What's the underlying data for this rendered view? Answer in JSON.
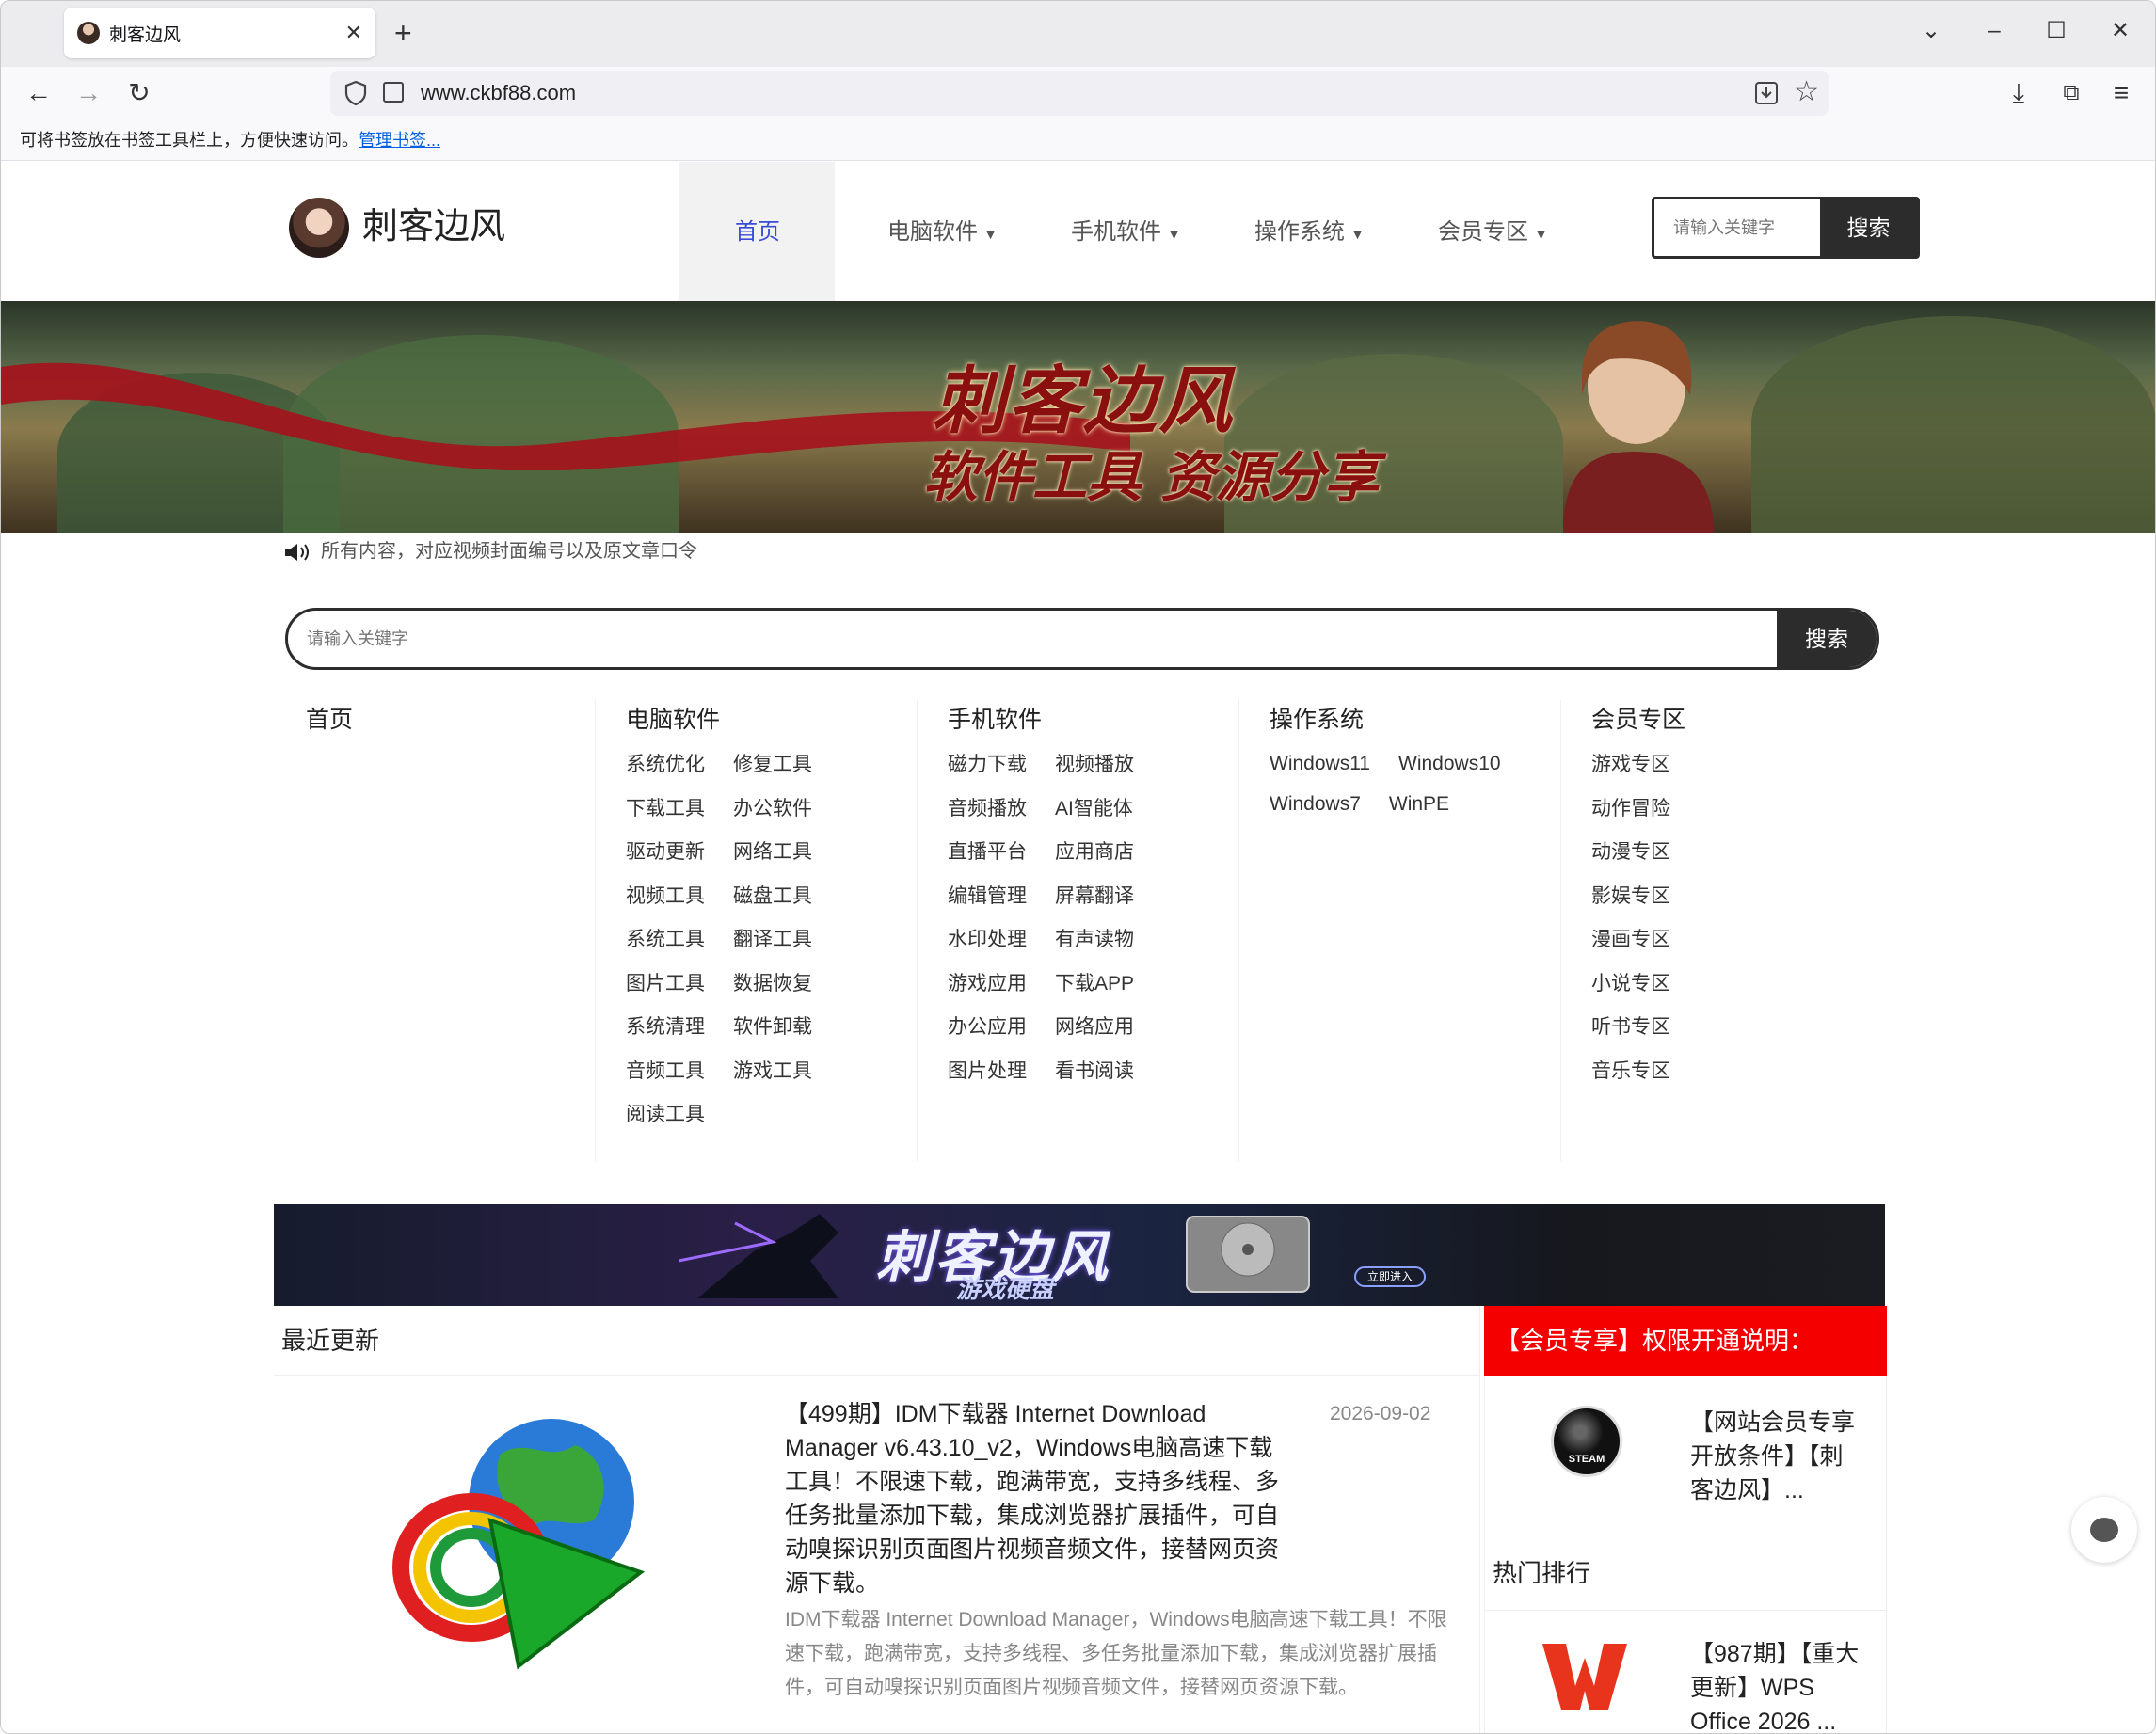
{
  "browser": {
    "tab_title": "刺客边风",
    "url": "www.ckbf88.com",
    "bookmark_hint": "可将书签放在书签工具栏上，方便快速访问。",
    "bookmark_link": "管理书签..."
  },
  "header": {
    "logo_text": "刺客边风",
    "nav": [
      "首页",
      "电脑软件",
      "手机软件",
      "操作系统",
      "会员专区"
    ],
    "search_placeholder": "请输入关键字",
    "search_button": "搜索"
  },
  "banner": {
    "title": "刺客边风",
    "subtitle": "软件工具 资源分享"
  },
  "notice": "所有内容，对应视频封面编号以及原文章口令",
  "big_search": {
    "placeholder": "请输入关键字",
    "button": "搜索"
  },
  "categories": {
    "home": "首页",
    "pc": {
      "title": "电脑软件",
      "items": [
        "系统优化",
        "修复工具",
        "下载工具",
        "办公软件",
        "驱动更新",
        "网络工具",
        "视频工具",
        "磁盘工具",
        "系统工具",
        "翻译工具",
        "图片工具",
        "数据恢复",
        "系统清理",
        "软件卸载",
        "音频工具",
        "游戏工具",
        "阅读工具"
      ]
    },
    "mobile": {
      "title": "手机软件",
      "items": [
        "磁力下载",
        "视频播放",
        "音频播放",
        "AI智能体",
        "直播平台",
        "应用商店",
        "编辑管理",
        "屏幕翻译",
        "水印处理",
        "有声读物",
        "游戏应用",
        "下载APP",
        "办公应用",
        "网络应用",
        "图片处理",
        "看书阅读"
      ]
    },
    "os": {
      "title": "操作系统",
      "items": [
        "Windows11",
        "Windows10",
        "Windows7",
        "WinPE"
      ]
    },
    "vip": {
      "title": "会员专区",
      "items": [
        "游戏专区",
        "动作冒险",
        "动漫专区",
        "影娱专区",
        "漫画专区",
        "小说专区",
        "听书专区",
        "音乐专区"
      ]
    }
  },
  "ad": {
    "title": "刺客边风",
    "subtitle": "游戏硬盘",
    "button": "立即进入"
  },
  "recent": {
    "header": "最近更新",
    "post": {
      "title": "【499期】IDM下载器 Internet Download Manager v6.43.10_v2，Windows电脑高速下载工具！不限速下载，跑满带宽，支持多线程、多任务批量添加下载，集成浏览器扩展插件，可自动嗅探识别页面图片视频音频文件，接替网页资源下载。",
      "date": "2026-09-02",
      "desc": "IDM下载器 Internet Download Manager，Windows电脑高速下载工具！不限速下载，跑满带宽，支持多线程、多任务批量添加下载，集成浏览器扩展插件，可自动嗅探识别页面图片视频音频文件，接替网页资源下载。"
    }
  },
  "sidebar": {
    "vip_header": "【会员专享】权限开通说明：",
    "vip_post": "【网站会员专享开放条件】【刺客边风】...",
    "steam_label": "STEAM",
    "hot_header": "热门排行",
    "hot_post": "【987期】【重大更新】WPS Office 2026 ..."
  },
  "colors": {
    "accent_nav": "#3a4cd6",
    "vip_red": "#f40000",
    "dark_button": "#2c2c2c"
  }
}
